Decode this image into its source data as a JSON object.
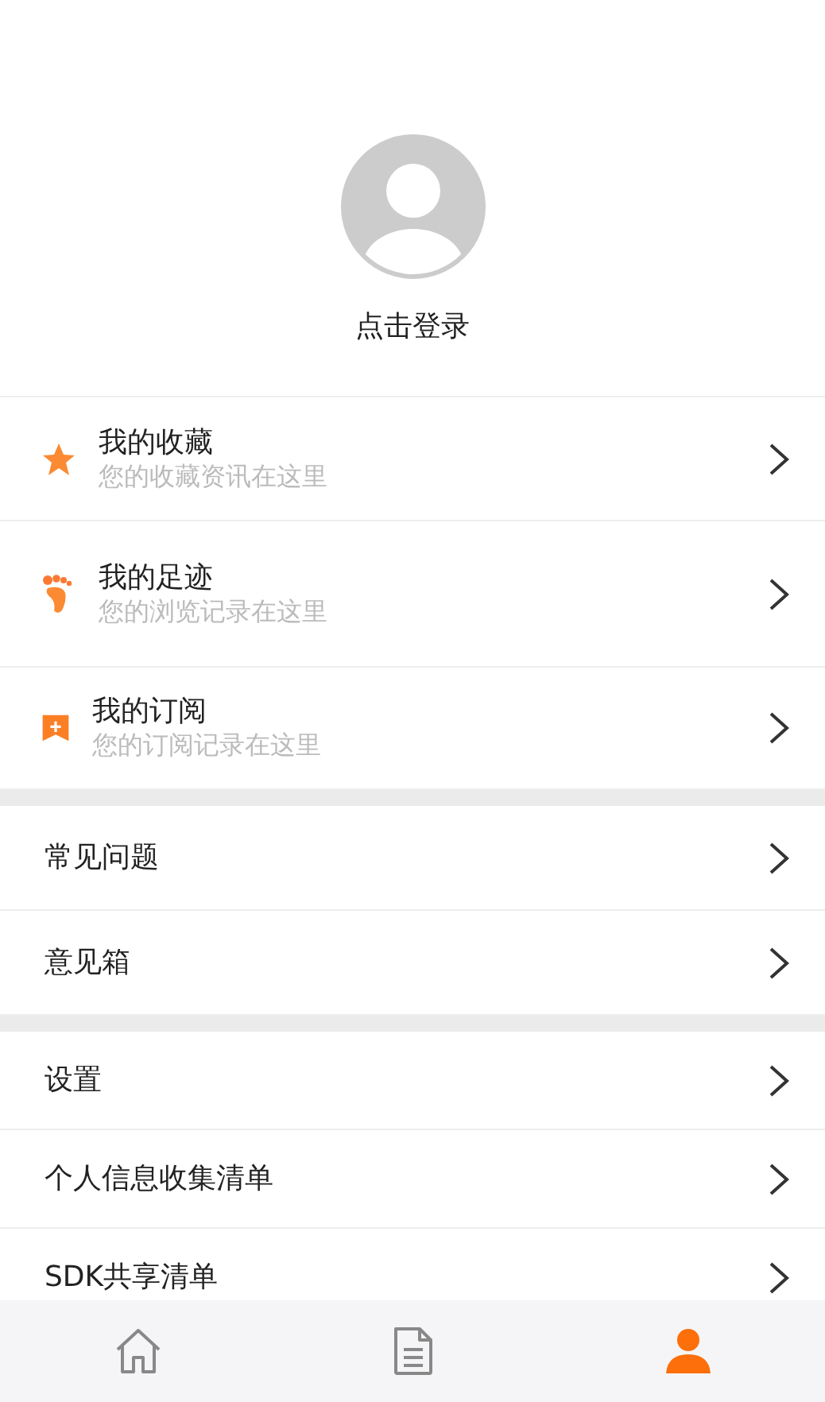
{
  "profile": {
    "login_label": "点击登录"
  },
  "features": [
    {
      "kind": "star",
      "title": "我的收藏",
      "subtitle": "您的收藏资讯在这里"
    },
    {
      "kind": "footprint",
      "title": "我的足迹",
      "subtitle": "您的浏览记录在这里"
    },
    {
      "kind": "bookmark",
      "title": "我的订阅",
      "subtitle": "您的订阅记录在这里"
    }
  ],
  "groups": [
    {
      "items": [
        {
          "label": "常见问题"
        },
        {
          "label": "意见箱"
        }
      ]
    },
    {
      "items": [
        {
          "label": "设置"
        },
        {
          "label": "个人信息收集清单"
        },
        {
          "label": "SDK共享清单"
        }
      ]
    }
  ],
  "tab_bar": [
    {
      "kind": "home",
      "selected": false
    },
    {
      "kind": "document",
      "selected": false
    },
    {
      "kind": "person",
      "selected": true
    }
  ]
}
